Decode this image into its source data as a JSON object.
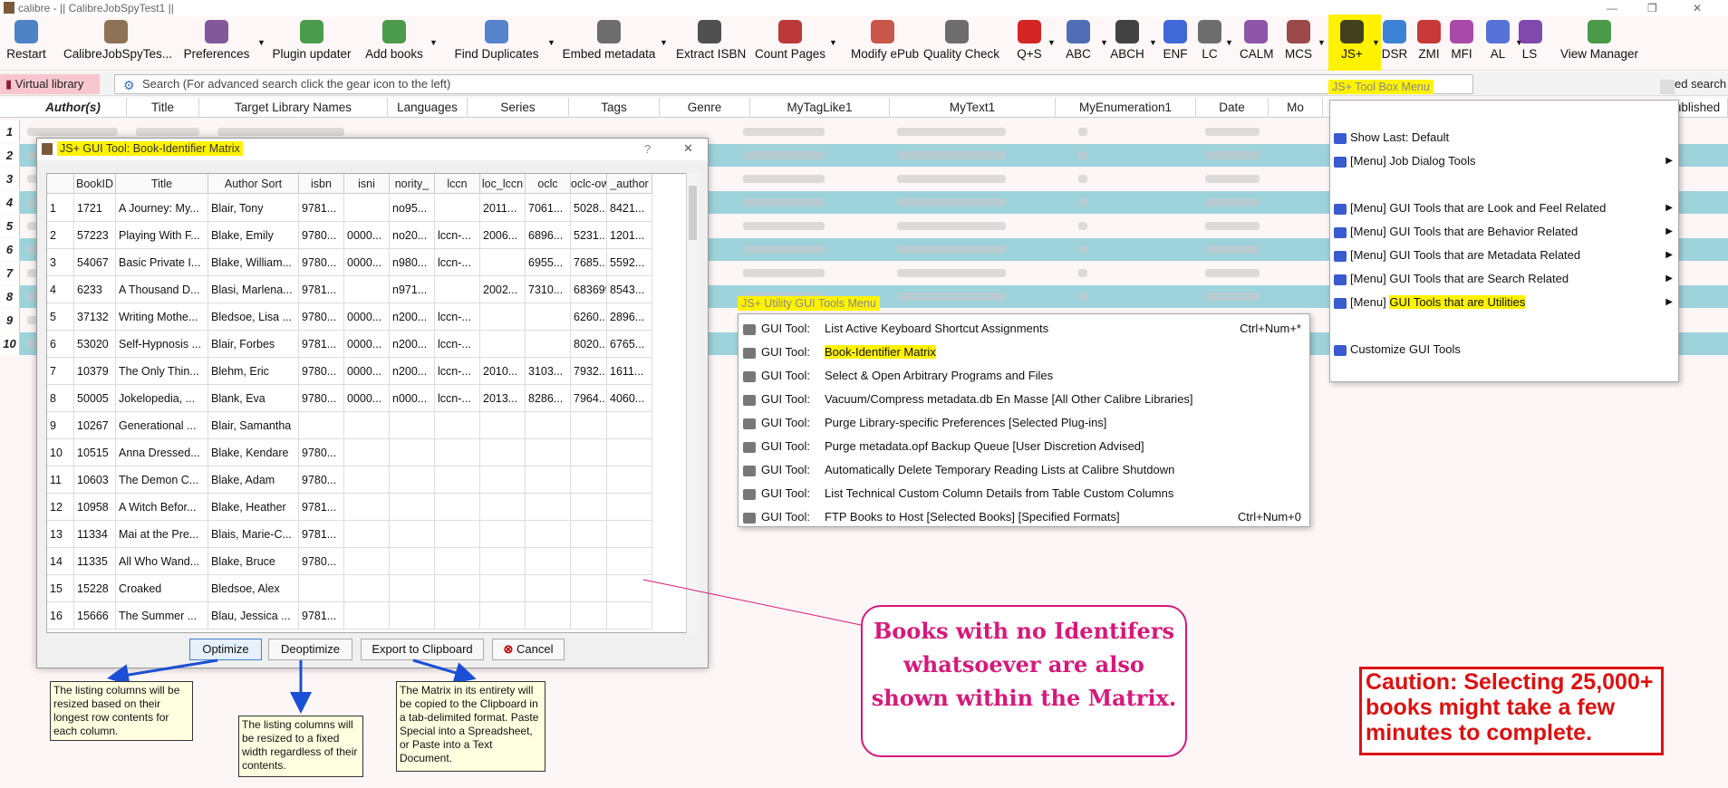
{
  "titlebar": {
    "title": "calibre - || CalibreJobSpyTest1 ||",
    "min": "—",
    "max": "❐",
    "close": "✕"
  },
  "toolbar": {
    "items": [
      {
        "name": "restart",
        "label": "Restart",
        "dd": false
      },
      {
        "name": "library",
        "label": "CalibreJobSpyTes...",
        "dd": false
      },
      {
        "name": "preferences",
        "label": "Preferences",
        "dd": true
      },
      {
        "name": "plugin-updater",
        "label": "Plugin updater",
        "dd": false
      },
      {
        "name": "add-books",
        "label": "Add books",
        "dd": true
      },
      {
        "name": "find-duplicates",
        "label": "Find Duplicates",
        "dd": true
      },
      {
        "name": "embed-metadata",
        "label": "Embed metadata",
        "dd": true
      },
      {
        "name": "extract-isbn",
        "label": "Extract ISBN",
        "dd": false
      },
      {
        "name": "count-pages",
        "label": "Count Pages",
        "dd": true
      },
      {
        "name": "modify-epub",
        "label": "Modify ePub",
        "dd": false
      },
      {
        "name": "quality-check",
        "label": "Quality Check",
        "dd": false
      },
      {
        "name": "q-s",
        "label": "Q+S",
        "dd": true
      },
      {
        "name": "abc",
        "label": "ABC",
        "dd": true
      },
      {
        "name": "abch",
        "label": "ABCH",
        "dd": true
      },
      {
        "name": "enf",
        "label": "ENF",
        "dd": false
      },
      {
        "name": "lc",
        "label": "LC",
        "dd": true
      },
      {
        "name": "calm",
        "label": "CALM",
        "dd": false
      },
      {
        "name": "mcs",
        "label": "MCS",
        "dd": true
      },
      {
        "name": "js-plus",
        "label": "JS+",
        "dd": true
      },
      {
        "name": "dsr",
        "label": "DSR",
        "dd": false
      },
      {
        "name": "zmi",
        "label": "ZMI",
        "dd": false
      },
      {
        "name": "mfi",
        "label": "MFI",
        "dd": false
      },
      {
        "name": "al",
        "label": "AL",
        "dd": true
      },
      {
        "name": "ls",
        "label": "LS",
        "dd": false
      },
      {
        "name": "view-manager",
        "label": "View Manager",
        "dd": false
      }
    ]
  },
  "virtual_library": "Virtual library",
  "search": {
    "placeholder": "Search (For advanced search click the gear icon to the left)",
    "right_text": "ed search"
  },
  "columns": [
    "Author(s)",
    "Title",
    "Target Library Names",
    "Languages",
    "Series",
    "Tags",
    "Genre",
    "MyTagLike1",
    "MyText1",
    "MyEnumeration1",
    "Date",
    "Mo",
    "ublished"
  ],
  "library_rows": [
    "1",
    "2",
    "3",
    "4",
    "5",
    "6",
    "7",
    "8",
    "9",
    "10"
  ],
  "dialog": {
    "title": "JS+ GUI Tool: Book-Identifier Matrix",
    "help": "?",
    "close": "✕",
    "headers": [
      "",
      "BookID",
      "Title",
      "Author Sort",
      "isbn",
      "isni",
      "nority_",
      "lccn",
      "loc_lccn",
      "oclc",
      "oclc-owi",
      "_author"
    ],
    "rows": [
      [
        "1",
        "1721",
        "A Journey: My...",
        "Blair, Tony",
        "9781...",
        "",
        "no95...",
        "",
        "2011...",
        "7061...",
        "5028...",
        "8421..."
      ],
      [
        "2",
        "57223",
        "Playing With F...",
        "Blake, Emily",
        "9780...",
        "0000...",
        "no20...",
        "lccn-...",
        "2006...",
        "6896...",
        "5231...",
        "1201..."
      ],
      [
        "3",
        "54067",
        "Basic Private I...",
        "Blake, William...",
        "9780...",
        "0000...",
        "n980...",
        "lccn-...",
        "",
        "6955...",
        "7685...",
        "5592..."
      ],
      [
        "4",
        "6233",
        "A Thousand D...",
        "Blasi, Marlena...",
        "9781...",
        "",
        "n971...",
        "",
        "2002...",
        "7310...",
        "683699",
        "8543..."
      ],
      [
        "5",
        "37132",
        "Writing Mothe...",
        "Bledsoe, Lisa ...",
        "9780...",
        "0000...",
        "n200...",
        "lccn-...",
        "",
        "",
        "6260...",
        "2896..."
      ],
      [
        "6",
        "53020",
        "Self-Hypnosis ...",
        "Blair, Forbes",
        "9781...",
        "0000...",
        "n200...",
        "lccn-...",
        "",
        "",
        "8020...",
        "6765..."
      ],
      [
        "7",
        "10379",
        "The Only Thin...",
        "Blehm, Eric",
        "9780...",
        "0000...",
        "n200...",
        "lccn-...",
        "2010...",
        "3103...",
        "7932...",
        "1611..."
      ],
      [
        "8",
        "50005",
        "Jokelopedia, ...",
        "Blank, Eva",
        "9780...",
        "0000...",
        "n000...",
        "lccn-...",
        "2013...",
        "8286...",
        "7964...",
        "4060..."
      ],
      [
        "9",
        "10267",
        "Generational ...",
        "Blair, Samantha",
        "",
        "",
        "",
        "",
        "",
        "",
        "",
        ""
      ],
      [
        "10",
        "10515",
        "Anna Dressed...",
        "Blake, Kendare",
        "9780...",
        "",
        "",
        "",
        "",
        "",
        "",
        ""
      ],
      [
        "11",
        "10603",
        "The Demon C...",
        "Blake, Adam",
        "9780...",
        "",
        "",
        "",
        "",
        "",
        "",
        ""
      ],
      [
        "12",
        "10958",
        "A Witch Befor...",
        "Blake, Heather",
        "9781...",
        "",
        "",
        "",
        "",
        "",
        "",
        ""
      ],
      [
        "13",
        "11334",
        "Mai at the Pre...",
        "Blais, Marie-C...",
        "9781...",
        "",
        "",
        "",
        "",
        "",
        "",
        ""
      ],
      [
        "14",
        "11335",
        "All Who Wand...",
        "Blake, Bruce",
        "9780...",
        "",
        "",
        "",
        "",
        "",
        "",
        ""
      ],
      [
        "15",
        "15228",
        "Croaked",
        "Bledsoe, Alex",
        "",
        "",
        "",
        "",
        "",
        "",
        "",
        ""
      ],
      [
        "16",
        "15666",
        "The Summer ...",
        "Blau, Jessica ...",
        "9781...",
        "",
        "",
        "",
        "",
        "",
        "",
        ""
      ]
    ],
    "buttons": {
      "optimize": "Optimize",
      "deoptimize": "Deoptimize",
      "export": "Export to Clipboard",
      "cancel": "Cancel"
    }
  },
  "toolbox_menu": {
    "title": "JS+ Tool Box Menu",
    "items": [
      {
        "label": "Show Last: Default",
        "sub": false,
        "icon": "eye-icon"
      },
      {
        "label": "[Menu] Job Dialog Tools",
        "sub": true,
        "icon": "eye-icon"
      },
      {
        "label": "[Menu] GUI Tools that are Look and Feel Related",
        "sub": true,
        "icon": "brush-icon"
      },
      {
        "label": "[Menu] GUI Tools that are Behavior Related",
        "sub": true,
        "icon": "gear-icon"
      },
      {
        "label": "[Menu] GUI Tools that are Metadata Related",
        "sub": true,
        "icon": "column-icon"
      },
      {
        "label": "[Menu] GUI Tools that are Search Related",
        "sub": true,
        "icon": "binoculars-icon"
      },
      {
        "label_prefix": "[Menu] ",
        "label_hl": "GUI Tools that are Utilities",
        "sub": true,
        "icon": "wand-icon"
      },
      {
        "label": "Customize GUI Tools",
        "sub": false,
        "icon": "tools-icon"
      }
    ]
  },
  "utility_menu": {
    "title": "JS+ Utility GUI Tools Menu",
    "prefix": "GUI Tool:",
    "items": [
      {
        "label": "List Active Keyboard Shortcut Assignments",
        "shortcut": "Ctrl+Num+*"
      },
      {
        "label": "Book-Identifier Matrix",
        "shortcut": "",
        "hl": true
      },
      {
        "label": "Select & Open Arbitrary Programs and Files",
        "shortcut": ""
      },
      {
        "label": "Vacuum/Compress metadata.db En Masse [All Other Calibre Libraries]",
        "shortcut": ""
      },
      {
        "label": "Purge Library-specific Preferences [Selected Plug-ins]",
        "shortcut": ""
      },
      {
        "label": "Purge metadata.opf Backup Queue [User Discretion Advised]",
        "shortcut": ""
      },
      {
        "label": "Automatically Delete Temporary Reading Lists at Calibre Shutdown",
        "shortcut": ""
      },
      {
        "label": "List Technical Custom Column Details from Table Custom Columns",
        "shortcut": ""
      },
      {
        "label": "FTP Books to Host [Selected Books] [Specified Formats]",
        "shortcut": "Ctrl+Num+0"
      }
    ]
  },
  "notes": {
    "optimize": "The listing columns will be resized based on their longest row contents for each column.",
    "deoptimize": "The listing columns will be resized to a fixed width regardless of their contents.",
    "export": "The Matrix in its entirety will be copied to the Clipboard in a tab-delimited format. Paste Special into a Spreadsheet, or Paste into a Text Document."
  },
  "callout": "Books with no Identifers whatsoever are also shown within the Matrix.",
  "caution": "Caution: Selecting 25,000+ books might take a few minutes to complete.",
  "colors": {
    "highlight": "#fff200",
    "callout": "#d6197a",
    "caution": "#dd1111",
    "row_alt": "#9fd3dc"
  }
}
